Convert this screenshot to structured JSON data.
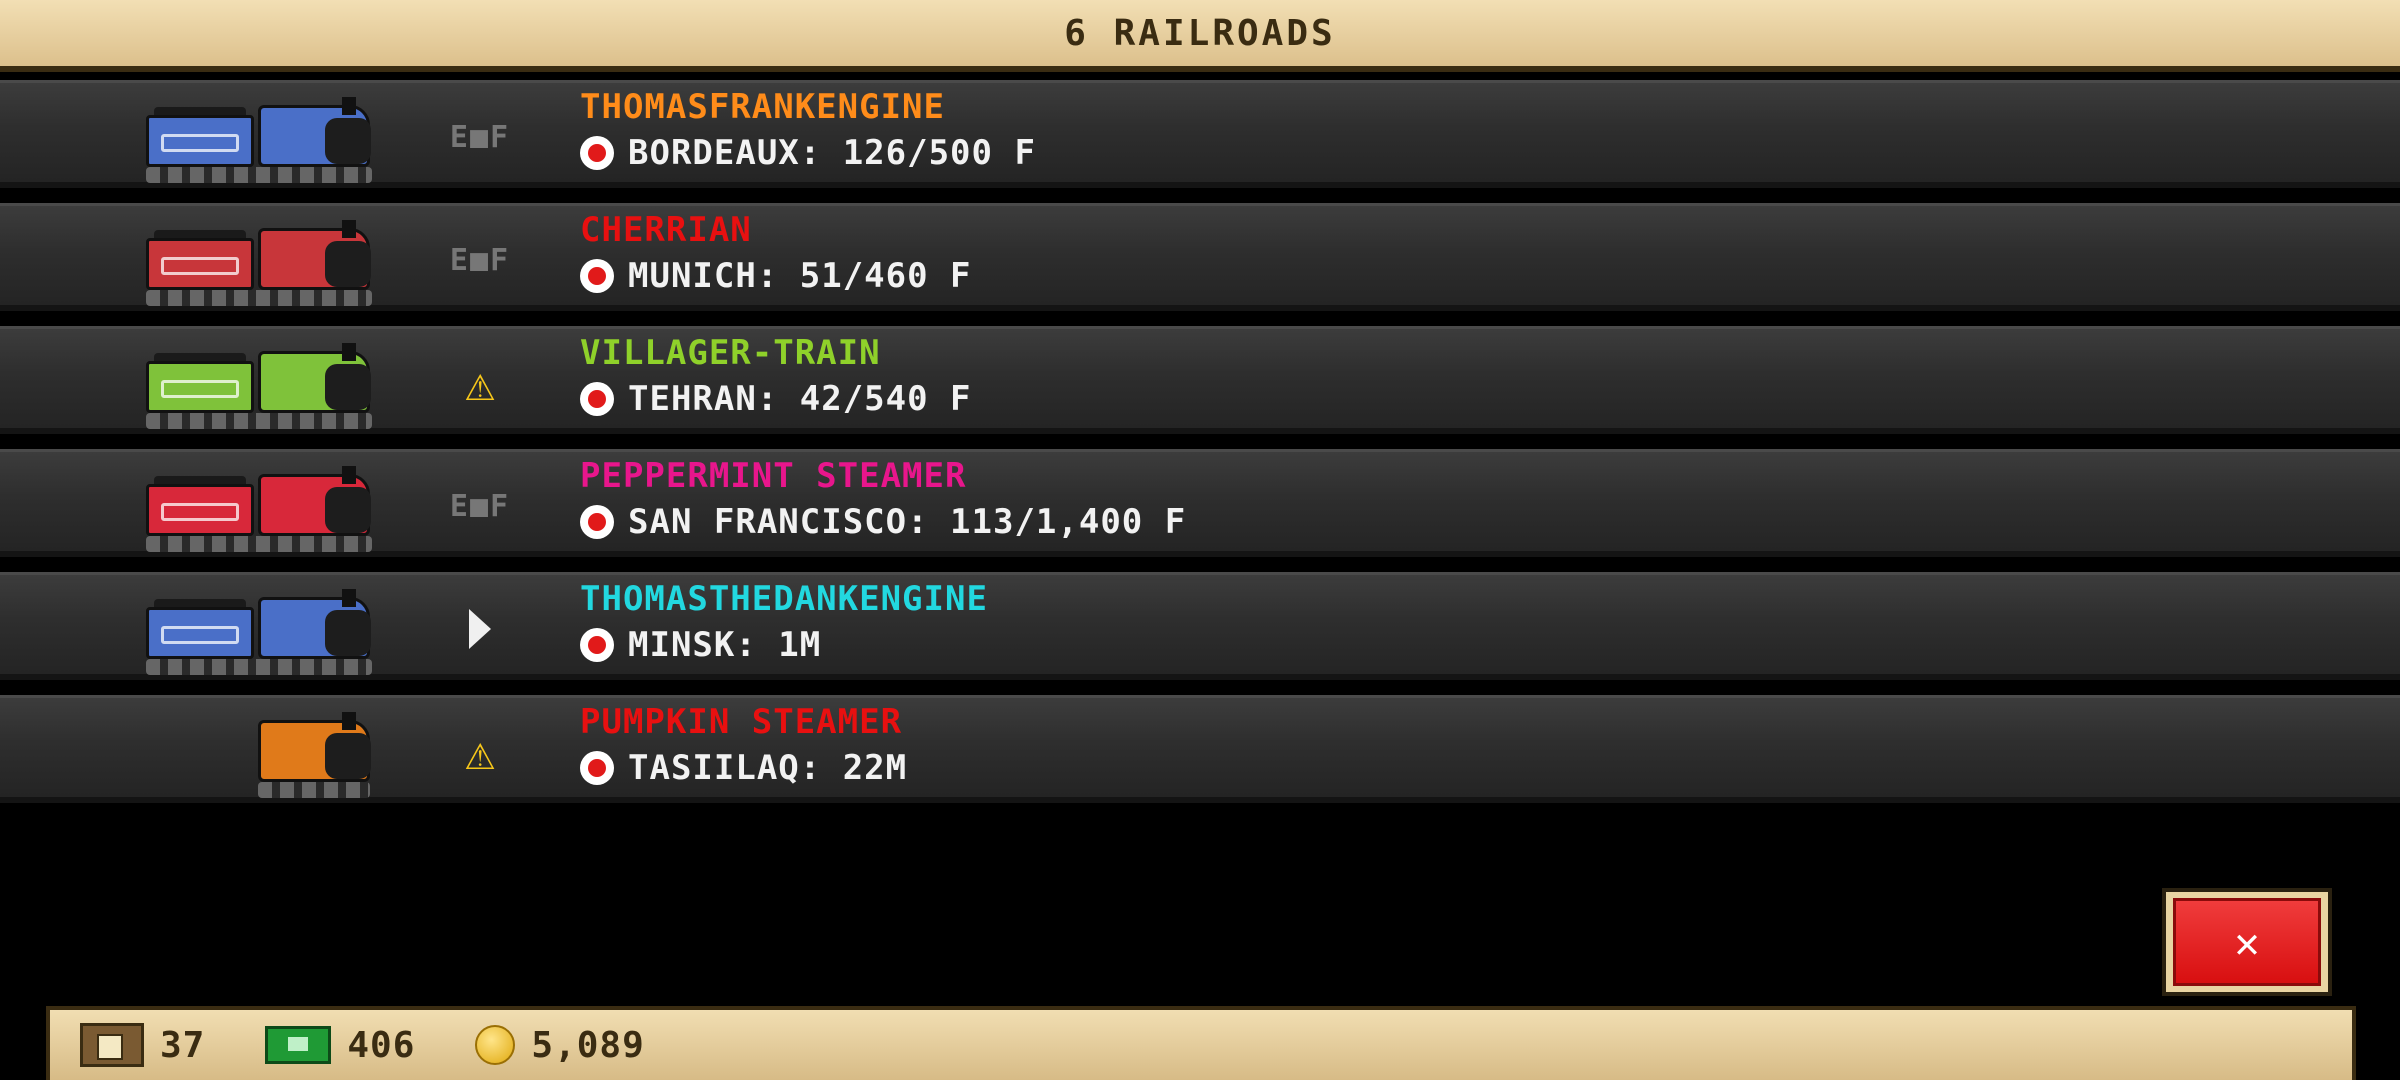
{
  "header": {
    "title": "6 RAILROADS"
  },
  "railroads": [
    {
      "name": "THOMASFRANKENGINE",
      "name_color": "#ff8c1a",
      "train_color": "#4a6fc8",
      "train_icon": "steam-train-blue-icon",
      "status_icon": "fuel-gauge-icon",
      "status_label": "E■F",
      "destination": "BORDEAUX: 126/500 F"
    },
    {
      "name": "CHERRIAN",
      "name_color": "#e81010",
      "train_color": "#c8363a",
      "train_icon": "steam-train-red-icon",
      "status_icon": "fuel-gauge-icon",
      "status_label": "E■F",
      "destination": "MUNICH: 51/460 F"
    },
    {
      "name": "VILLAGER-TRAIN",
      "name_color": "#8fd12a",
      "train_color": "#7fc23a",
      "train_icon": "steam-train-green-icon",
      "status_icon": "warning-icon",
      "status_label": "⚠",
      "destination": "TEHRAN: 42/540 F"
    },
    {
      "name": "PEPPERMINT STEAMER",
      "name_color": "#e8168c",
      "train_color": "#d8283a",
      "train_icon": "peppermint-steam-train-icon",
      "status_icon": "fuel-gauge-icon",
      "status_label": "E■F",
      "destination": "SAN FRANCISCO: 113/1,400 F"
    },
    {
      "name": "THOMASTHEDANKENGINE",
      "name_color": "#22d8e0",
      "train_color": "#4a6fc8",
      "train_icon": "steam-train-blue-icon",
      "status_icon": "play-icon",
      "status_label": "",
      "destination": "MINSK: 1M"
    },
    {
      "name": "PUMPKIN STEAMER",
      "name_color": "#e81010",
      "train_color": "#e07a1a",
      "train_icon": "pumpkin-steam-train-icon",
      "status_icon": "warning-icon",
      "status_label": "⚠",
      "destination": "TASIILAQ: 22M"
    }
  ],
  "close_button": {
    "label": "✕",
    "icon": "close-icon"
  },
  "footer": {
    "crates": {
      "icon": "crate-icon",
      "value": "37"
    },
    "cash": {
      "icon": "cash-icon",
      "value": "406"
    },
    "coins": {
      "icon": "coin-icon",
      "value": "5,089"
    }
  },
  "colors": {
    "header_bg": "#e8d2a0",
    "row_bg": "#2e2e2e",
    "close_red": "#e51b1b"
  }
}
